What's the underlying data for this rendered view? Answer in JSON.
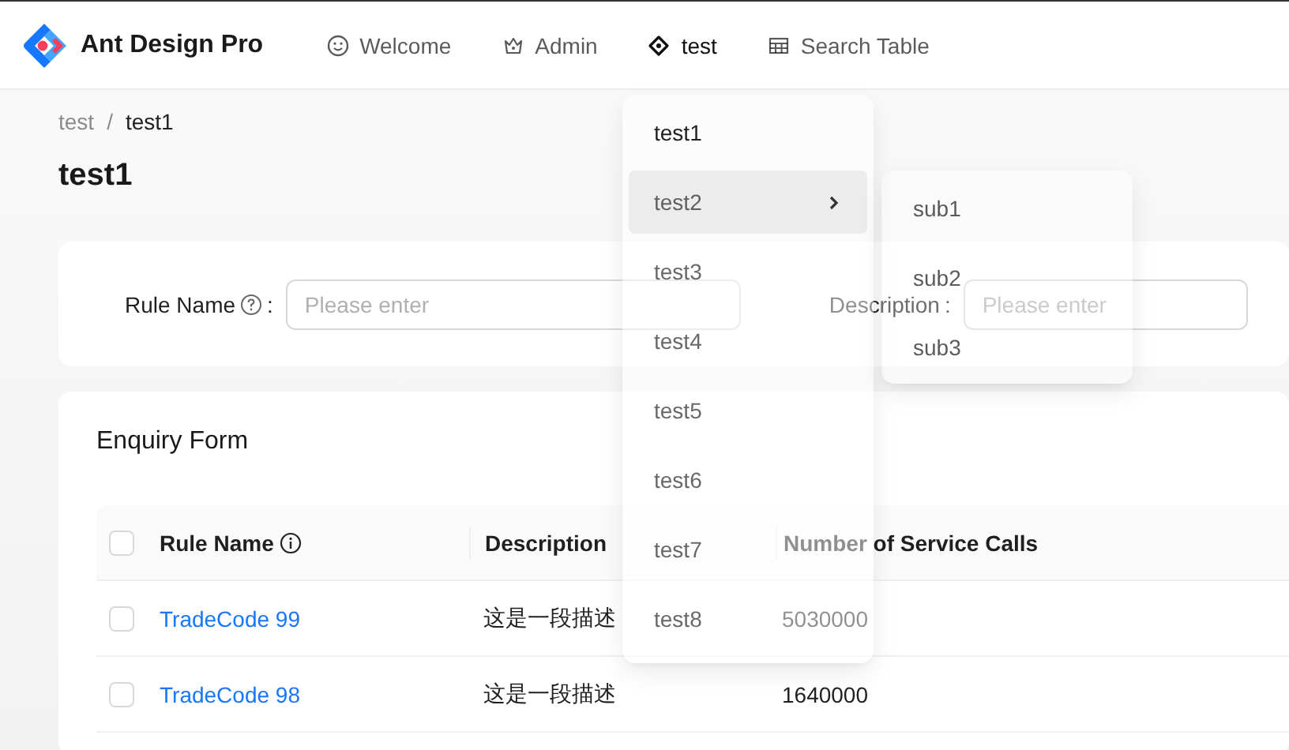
{
  "header": {
    "title": "Ant Design Pro",
    "nav": [
      {
        "label": "Welcome",
        "selected": false
      },
      {
        "label": "Admin",
        "selected": false
      },
      {
        "label": "test",
        "selected": true
      },
      {
        "label": "Search Table",
        "selected": false
      }
    ]
  },
  "dropdown": {
    "items": [
      {
        "label": "test1",
        "selected": true,
        "hovered": false
      },
      {
        "label": "test2",
        "selected": false,
        "hovered": true,
        "children": [
          {
            "label": "sub1"
          },
          {
            "label": "sub2"
          },
          {
            "label": "sub3"
          }
        ]
      },
      {
        "label": "test3",
        "selected": false,
        "hovered": false
      },
      {
        "label": "test4",
        "selected": false,
        "hovered": false
      },
      {
        "label": "test5",
        "selected": false,
        "hovered": false
      },
      {
        "label": "test6",
        "selected": false,
        "hovered": false
      },
      {
        "label": "test7",
        "selected": false,
        "hovered": false
      },
      {
        "label": "test8",
        "selected": false,
        "hovered": false
      }
    ]
  },
  "breadcrumb": {
    "items": [
      "test",
      "test1"
    ],
    "separator": "/"
  },
  "page_title": "test1",
  "search_form": {
    "fields": [
      {
        "label": "Rule Name",
        "help_icon": true,
        "colon": ":",
        "placeholder": "Please enter"
      },
      {
        "label": "Description",
        "help_icon": false,
        "colon": ":",
        "placeholder": "Please enter"
      }
    ]
  },
  "table": {
    "title": "Enquiry Form",
    "header_checked": false,
    "columns": [
      {
        "title": "Rule Name",
        "info_icon": true
      },
      {
        "title": "Description",
        "info_icon": false
      },
      {
        "title": "Number of Service Calls",
        "info_icon": false
      }
    ],
    "rows": [
      {
        "checked": false,
        "cells": [
          "TradeCode 99",
          "这是一段描述",
          "5030000"
        ]
      },
      {
        "checked": false,
        "cells": [
          "TradeCode 98",
          "这是一段描述",
          "1640000"
        ]
      }
    ]
  }
}
